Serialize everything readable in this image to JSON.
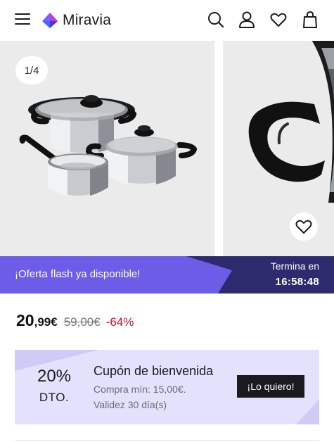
{
  "header": {
    "logo_text": "Miravia",
    "icons": [
      "menu-icon",
      "search-icon",
      "account-icon",
      "heart-icon",
      "bag-icon"
    ]
  },
  "gallery": {
    "counter": "1/4"
  },
  "flash": {
    "text": "¡Oferta flash ya disponible!",
    "ends_label": "Termina en",
    "time": "16:58:48"
  },
  "price": {
    "current_int": "20",
    "current_dec": ",99€",
    "original": "59,00€",
    "discount": "-64%"
  },
  "coupon": {
    "percent": "20%",
    "dto": "DTO.",
    "title": "Cupón de bienvenida",
    "min_purchase": "Compra mín: 15,00€.",
    "validity": "Validez 30 día(s)",
    "button": "¡Lo quiero!"
  },
  "colors": {
    "flash_purple": "#6c5ce7",
    "flash_dark": "#2d2a6e",
    "coupon_bg": "#dcdafa",
    "discount_red": "#c8102e"
  }
}
